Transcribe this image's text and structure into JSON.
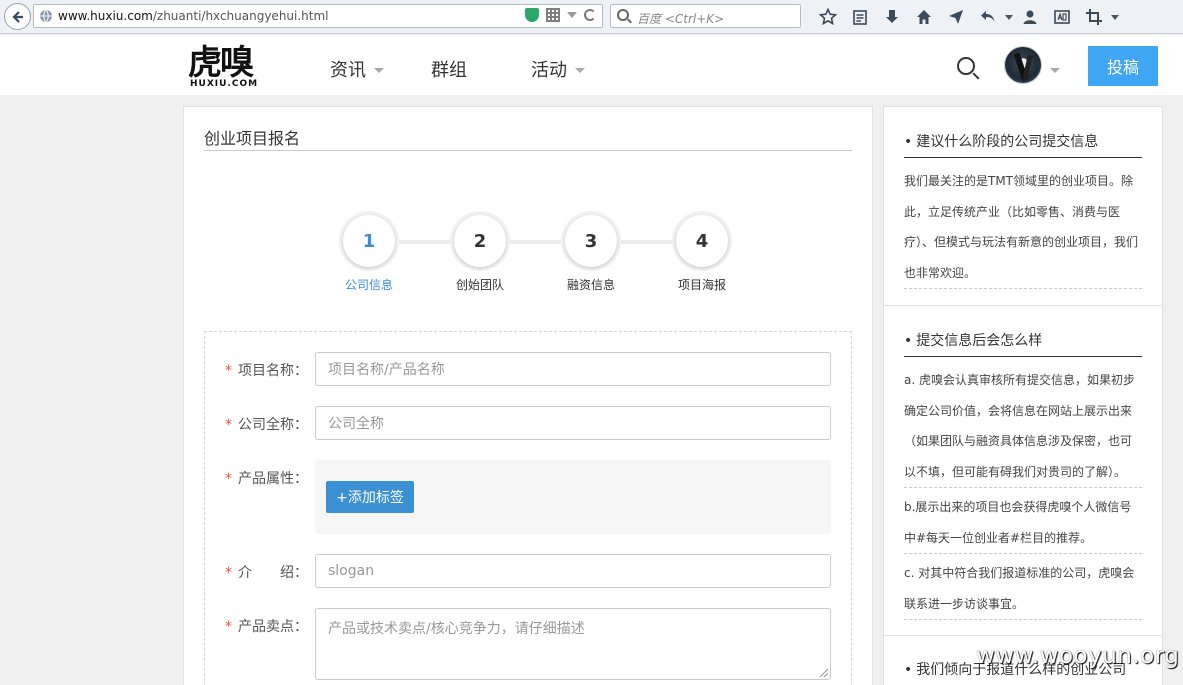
{
  "browser": {
    "url_host": "www.huxiu.com",
    "url_path": "/zhuanti/hxchuangyehui.html",
    "search_placeholder": "百度 <Ctrl+K>"
  },
  "site": {
    "logo_cn": "虎嗅",
    "logo_en": "HUXIU.COM",
    "nav": [
      "资讯",
      "群组",
      "活动"
    ],
    "submit_label": "投稿"
  },
  "form": {
    "title": "创业项目报名",
    "steps": [
      {
        "num": "1",
        "label": "公司信息"
      },
      {
        "num": "2",
        "label": "创始团队"
      },
      {
        "num": "3",
        "label": "融资信息"
      },
      {
        "num": "4",
        "label": "项目海报"
      }
    ],
    "active_step": 1,
    "fields": {
      "project_name_label": "项目名称：",
      "project_name_placeholder": "项目名称/产品名称",
      "company_name_label": "公司全称：",
      "company_name_placeholder": "公司全称",
      "product_attr_label": "产品属性：",
      "add_tag_label": "+添加标签",
      "intro_label": "介　　绍：",
      "intro_placeholder": "slogan",
      "selling_point_label": "产品卖点：",
      "selling_point_placeholder": "产品或技术卖点/核心竞争力，请仔细描述"
    }
  },
  "sidebar": {
    "sections": [
      {
        "title": "建议什么阶段的公司提交信息",
        "paras": [
          "我们最关注的是TMT领域里的创业项目。除此，立足传统产业（比如零售、消费与医疗）、但模式与玩法有新意的创业项目，我们也非常欢迎。"
        ]
      },
      {
        "title": "提交信息后会怎么样",
        "paras": [
          "a. 虎嗅会认真审核所有提交信息，如果初步确定公司价值，会将信息在网站上展示出来（如果团队与融资具体信息涉及保密，也可以不填，但可能有碍我们对贵司的了解）。",
          "b.展示出来的项目也会获得虎嗅个人微信号中#每天一位创业者#栏目的推荐。",
          "c. 对其中符合我们报道标准的公司，虎嗅会联系进一步访谈事宜。"
        ]
      },
      {
        "title": "我们倾向于报道什么样的创业公司",
        "paras": []
      }
    ]
  },
  "watermark": "www.wooyun.org",
  "colors": {
    "accent_blue": "#3ea6f2",
    "button_blue": "#3b8fd3",
    "active_step": "#3a8fd5",
    "required": "#e5533d"
  }
}
